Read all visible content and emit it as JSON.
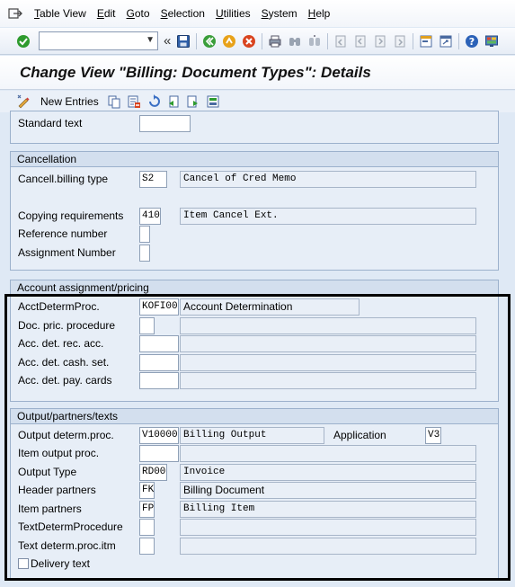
{
  "menubar": {
    "items": [
      {
        "u": "T",
        "rest": "able View"
      },
      {
        "u": "E",
        "rest": "dit"
      },
      {
        "u": "G",
        "rest": "oto"
      },
      {
        "u": "S",
        "rest": "election"
      },
      {
        "u": "U",
        "rest": "tilities"
      },
      {
        "u": "S",
        "rest": "ystem"
      },
      {
        "u": "H",
        "rest": "elp"
      }
    ]
  },
  "toolbar": {
    "command_value": ""
  },
  "title": "Change View \"Billing: Document Types\": Details",
  "apptoolbar": {
    "new_entries": "New Entries"
  },
  "top_group": {
    "standard_text_label": "Standard text",
    "standard_text_value": ""
  },
  "cancellation": {
    "title": "Cancellation",
    "cancel_billing_type_label": "Cancell.billing type",
    "cancel_billing_type_value": "S2",
    "cancel_billing_type_desc": "Cancel of Cred Memo",
    "copying_req_label": "Copying requirements",
    "copying_req_value": "410",
    "copying_req_desc": "Item Cancel Ext.",
    "reference_number_label": "Reference number",
    "reference_number_value": "",
    "assignment_number_label": "Assignment Number",
    "assignment_number_value": ""
  },
  "account": {
    "title": "Account assignment/pricing",
    "acct_determ_label": "AcctDetermProc.",
    "acct_determ_value": "KOFI00",
    "acct_determ_desc": "Account Determination",
    "doc_pric_label": "Doc. pric. procedure",
    "doc_pric_value": "",
    "rec_acc_label": "Acc. det. rec. acc.",
    "rec_acc_value": "",
    "cash_set_label": "Acc. det. cash. set.",
    "cash_set_value": "",
    "pay_cards_label": "Acc. det. pay. cards",
    "pay_cards_value": ""
  },
  "output": {
    "title": "Output/partners/texts",
    "output_determ_label": "Output determ.proc.",
    "output_determ_value": "V10000",
    "output_determ_desc": "Billing Output",
    "application_label": "Application",
    "application_value": "V3",
    "item_output_label": "Item output proc.",
    "item_output_value": "",
    "output_type_label": "Output Type",
    "output_type_value": "RD00",
    "output_type_desc": "Invoice",
    "header_partners_label": "Header partners",
    "header_partners_value": "FK",
    "header_partners_desc": "Billing Document",
    "item_partners_label": "Item partners",
    "item_partners_value": "FP",
    "item_partners_desc": "Billing Item",
    "text_determ_label": "TextDetermProcedure",
    "text_determ_value": "",
    "text_determ_itm_label": "Text determ.proc.itm",
    "text_determ_itm_value": "",
    "delivery_text_label": "Delivery text",
    "delivery_text_checked": false
  }
}
